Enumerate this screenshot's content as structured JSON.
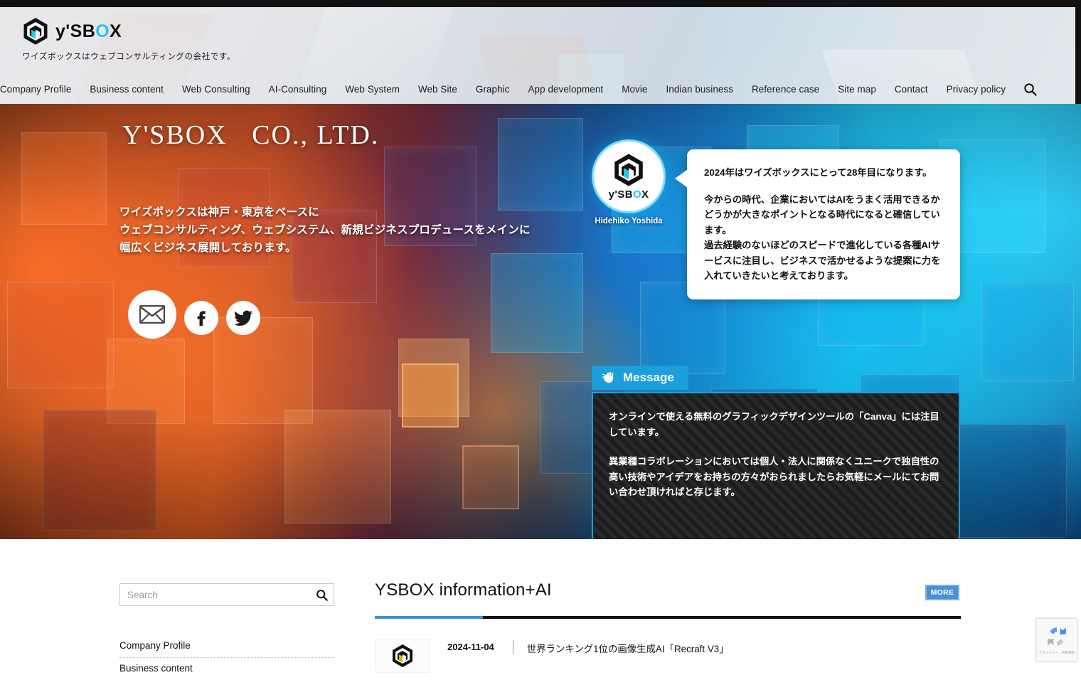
{
  "topbar": {
    "color": "#121212"
  },
  "header": {
    "logo_text_main": "y'SB",
    "logo_text_accent": "O",
    "logo_text_tail": "X",
    "logo_icon": "cube-logo-icon",
    "tagline": "ワイズボックスはウェブコンサルティングの会社です。",
    "nav": [
      {
        "label": "Company Profile",
        "active": false
      },
      {
        "label": "Business content",
        "active": false
      },
      {
        "label": "Web Consulting",
        "active": false
      },
      {
        "label": "AI-Consulting",
        "active": false
      },
      {
        "label": "Web System",
        "active": false
      },
      {
        "label": "Web Site",
        "active": false
      },
      {
        "label": "Graphic",
        "active": true
      },
      {
        "label": "App development",
        "active": false
      },
      {
        "label": "Movie",
        "active": false
      },
      {
        "label": "Indian business",
        "active": false
      },
      {
        "label": "Reference case",
        "active": false
      },
      {
        "label": "Site map",
        "active": false
      },
      {
        "label": "Contact",
        "active": false
      },
      {
        "label": "Privacy policy",
        "active": false
      }
    ],
    "search_icon": "search-icon"
  },
  "hero": {
    "title": "Y'SBOX   CO., LTD.",
    "lead_line1": "ワイズボックスは神戸・東京をベースに",
    "lead_line2": "ウェブコンサルティング、ウェブシステム、新規ビジネスプロデュースをメインに",
    "lead_line3": "幅広くビジネス展開しております。",
    "socials": [
      {
        "name": "mail-icon",
        "label": "Mail"
      },
      {
        "name": "facebook-icon",
        "label": "Facebook"
      },
      {
        "name": "twitter-icon",
        "label": "Twitter"
      }
    ],
    "avatar": {
      "word_main": "y'SB",
      "word_accent": "O",
      "word_tail": "X",
      "name": "Hidehiko Yoshida"
    },
    "speech": {
      "p1": "2024年はワイズボックスにとって28年目になります。",
      "p2": "今からの時代、企業においてはAIをうまく活用できるかどうかが大きなポイントとなる時代になると確信しています。\n過去経験のないほどのスピードで進化している各種AIサービスに注目し、ビジネスで活かせるような提案に力を入れていきたいと考えております。"
    },
    "message": {
      "tab_label": "Message",
      "tab_icon": "pointing-hand-icon",
      "p1": "オンラインで使える無料のグラフィックデザインツールの「Canva」には注目しています。",
      "p2": "異業種コラボレーションにおいては個人・法人に関係なくユニークで独自性の高い技術やアイデアをお持ちの方々がおられましたらお気軽にメールにてお問い合わせ頂ければと存じます。",
      "accent_color": "#1a9fdb"
    }
  },
  "sidebar": {
    "search": {
      "value": "",
      "placeholder": "Search",
      "icon": "search-icon"
    },
    "links": [
      {
        "label": "Company Profile"
      },
      {
        "label": "Business content"
      }
    ]
  },
  "news": {
    "title": "YSBOX information+AI",
    "more_label": "MORE",
    "accent_color": "#3d8fd0",
    "items": [
      {
        "thumb_icon": "cube-thumbnail-icon",
        "date": "2024-11-04",
        "text": "世界ランキング1位の画像生成AI「Recraft V3」"
      }
    ]
  },
  "recaptcha": {
    "icon": "recaptcha-icon",
    "text": "プライバシー - 利用規約"
  }
}
